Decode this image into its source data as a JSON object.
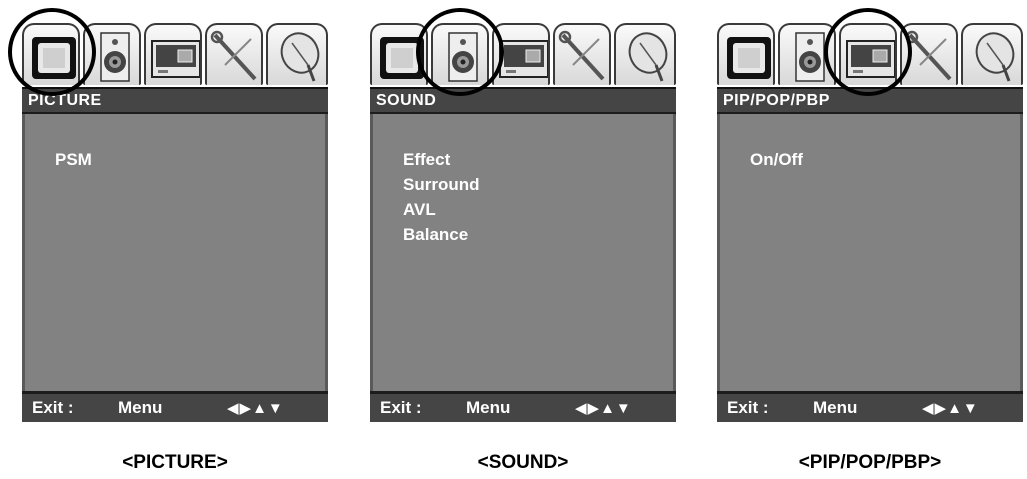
{
  "panels": [
    {
      "title": "PICTURE",
      "items": [
        "PSM"
      ],
      "footer": {
        "exit": "Exit :",
        "menu": "Menu",
        "nav": "◀▶▲▼"
      },
      "caption": "<PICTURE>"
    },
    {
      "title": "SOUND",
      "items": [
        "Effect",
        "Surround",
        "AVL",
        "Balance"
      ],
      "footer": {
        "exit": "Exit :",
        "menu": "Menu",
        "nav": "◀▶▲▼"
      },
      "caption": "<SOUND>"
    },
    {
      "title": "PIP/POP/PBP",
      "items": [
        "On/Off"
      ],
      "footer": {
        "exit": "Exit :",
        "menu": "Menu",
        "nav": "◀▶▲▼"
      },
      "caption": "<PIP/POP/PBP>"
    }
  ],
  "tab_icons": [
    "tv-icon",
    "speaker-icon",
    "pip-screen-icon",
    "wrench-icon",
    "satellite-dish-icon"
  ],
  "selected_tab_per_panel": [
    0,
    1,
    2
  ],
  "colors": {
    "title_bar": "#454545",
    "menu_body": "#828282",
    "text": "#ffffff",
    "highlight_ring": "#000000"
  }
}
